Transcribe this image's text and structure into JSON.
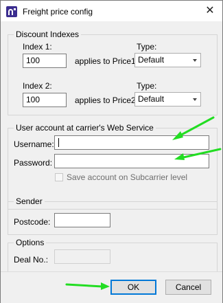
{
  "window": {
    "title": "Freight price config",
    "close_symbol": "✕"
  },
  "discount": {
    "group_label": "Discount Indexes",
    "index1_label": "Index 1:",
    "index1_value": "100",
    "index1_applies": "applies to  Price1",
    "type1_label": "Type:",
    "type1_value": "Default",
    "index2_label": "Index 2:",
    "index2_value": "100",
    "index2_applies": "applies to  Price2",
    "type2_label": "Type:",
    "type2_value": "Default"
  },
  "account": {
    "group_label": "User account at carrier's Web Service",
    "username_label": "Username:",
    "username_value": "",
    "password_label": "Password:",
    "password_value": "",
    "save_label": "Save account on Subcarrier level"
  },
  "sender": {
    "group_label": "Sender",
    "postcode_label": "Postcode:",
    "postcode_value": ""
  },
  "options": {
    "group_label": "Options",
    "deal_label": "Deal No.:",
    "deal_value": ""
  },
  "buttons": {
    "ok_label": "OK",
    "cancel_label": "Cancel"
  },
  "annotations": {
    "arrow_color": "#22dd22"
  }
}
